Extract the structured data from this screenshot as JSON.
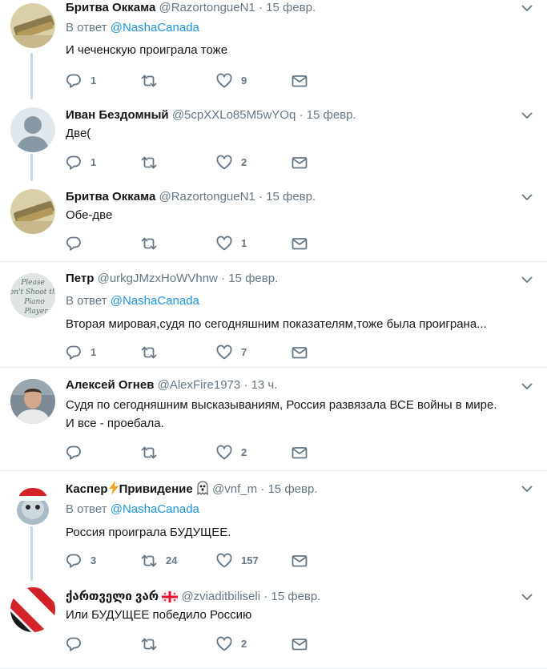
{
  "tweets": [
    {
      "name": "Бритва Оккама",
      "handle": "@RazortongueN1",
      "time": "15 февр.",
      "reply_prefix": "В ответ",
      "reply_to": "@NashaCanada",
      "text": "И чеченскую проиграла тоже",
      "replies": "1",
      "retweets": "",
      "likes": "9"
    },
    {
      "name": "Иван Бездомный",
      "handle": "@5cpXXLo85M5wYOq",
      "time": "15 февр.",
      "text": "Две(",
      "replies": "1",
      "retweets": "",
      "likes": "2"
    },
    {
      "name": "Бритва Оккама",
      "handle": "@RazortongueN1",
      "time": "15 февр.",
      "text": "Обе-две",
      "replies": "",
      "retweets": "",
      "likes": "1"
    },
    {
      "name": "Петр",
      "handle": "@urkgJMzxHoWVhnw",
      "time": "15 февр.",
      "reply_prefix": "В ответ",
      "reply_to": "@NashaCanada",
      "text": "Вторая мировая,судя по сегодняшним показателям,тоже была проиграна...",
      "replies": "1",
      "retweets": "",
      "likes": "7",
      "avatar_text": "Please don't Shoot the Piano Player"
    },
    {
      "name": "Алексей Огнев",
      "handle": "@AlexFire1973",
      "time": "13 ч.",
      "text": "Судя по сегодняшним высказываниям, Россия развязала ВСЕ войны в мире.",
      "text2": "И все - проебала.",
      "replies": "",
      "retweets": "",
      "likes": "2"
    },
    {
      "name": "Каспер",
      "name2": "Привидение",
      "handle": "@vnf_m",
      "time": "15 февр.",
      "reply_prefix": "В ответ",
      "reply_to": "@NashaCanada",
      "text": "Россия проиграла БУДУЩЕЕ.",
      "replies": "3",
      "retweets": "24",
      "likes": "157"
    },
    {
      "name": "ქართველი ვარ",
      "handle": "@zviaditbiliseli",
      "time": "15 февр.",
      "text": "Или БУДУЩЕЕ победило Россию",
      "replies": "",
      "retweets": "",
      "likes": "2"
    }
  ],
  "colors": {
    "accent": "#1b95e0",
    "secondary": "#657786",
    "icon": "#657786",
    "separator": "#e6ecf0",
    "thread": "#c4d9e7"
  },
  "icons": {
    "reply": "speech-bubble-icon",
    "retweet": "retweet-arrows-icon",
    "like": "heart-icon",
    "dm": "envelope-icon",
    "more": "chevron-down-icon"
  }
}
